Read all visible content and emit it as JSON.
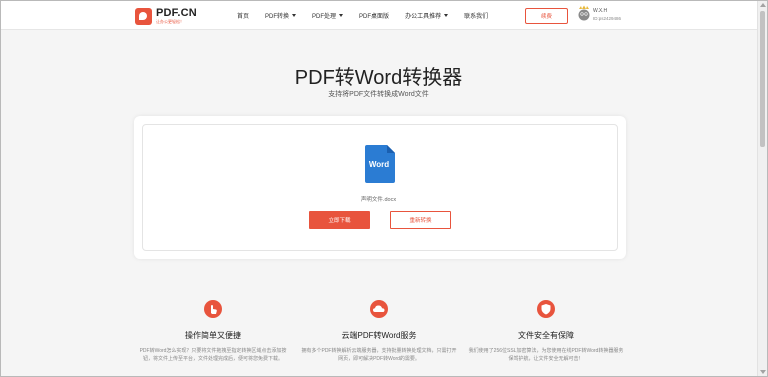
{
  "header": {
    "logo_name": "PDF.CN",
    "logo_sub": "让办公更轻松！",
    "nav": [
      {
        "label": "首页",
        "has_caret": false
      },
      {
        "label": "PDF转换",
        "has_caret": true
      },
      {
        "label": "PDF处理",
        "has_caret": true
      },
      {
        "label": "PDF桌面版",
        "has_caret": false
      },
      {
        "label": "办公工具推荐",
        "has_caret": true
      },
      {
        "label": "联系我们",
        "has_caret": false
      }
    ],
    "pay_label": "续费",
    "user_name": "W.X.H",
    "user_id": "ID:ps2429486"
  },
  "main": {
    "title": "PDF转Word转换器",
    "subtitle": "支持将PDF文件转换成Word文件",
    "file_label": "Word",
    "file_name": "声明文件.docx",
    "download_label": "立即下载",
    "reconvert_label": "重新转换"
  },
  "features": [
    {
      "title": "操作简单又便捷",
      "desc": "PDF转Word怎么实现？只要将文件拖拽至指定转换区域点击添加按钮，将文件上传至平台，文件处理完成后，便可将您免费下载。"
    },
    {
      "title": "云端PDF转Word服务",
      "desc": "拥有多个PDF转换解析云端服务器，支持批量转换处理文档，只需打开网页，即可解决PDF转Word的需要。"
    },
    {
      "title": "文件安全有保障",
      "desc": "我们使用了256位SSL加密算法，为您使用在线PDF转Word转换器服务保驾护航，让文件安全无解可击！"
    }
  ],
  "colors": {
    "accent": "#e8543d",
    "word_blue": "#2b7cd3"
  }
}
